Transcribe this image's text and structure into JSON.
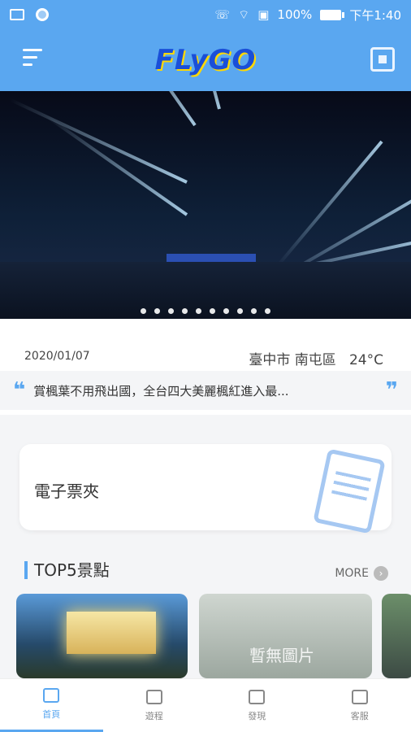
{
  "status": {
    "battery": "100%",
    "time": "下午1:40"
  },
  "header": {
    "logo": "FLyGO"
  },
  "hero": {
    "dots_count": 10
  },
  "info": {
    "date": "2020/01/07",
    "location": "臺中市 南屯區",
    "temperature": "24°C",
    "quote": "賞楓葉不用飛出國，全台四大美麗楓紅進入最..."
  },
  "wallet": {
    "label": "電子票夾"
  },
  "top5": {
    "title": "TOP5景點",
    "more": "MORE",
    "placeholder": "暫無圖片"
  },
  "nav": [
    {
      "label": "首頁"
    },
    {
      "label": "遊程"
    },
    {
      "label": "發現"
    },
    {
      "label": "客服"
    }
  ],
  "colors": {
    "brand": "#5aa7f0"
  }
}
